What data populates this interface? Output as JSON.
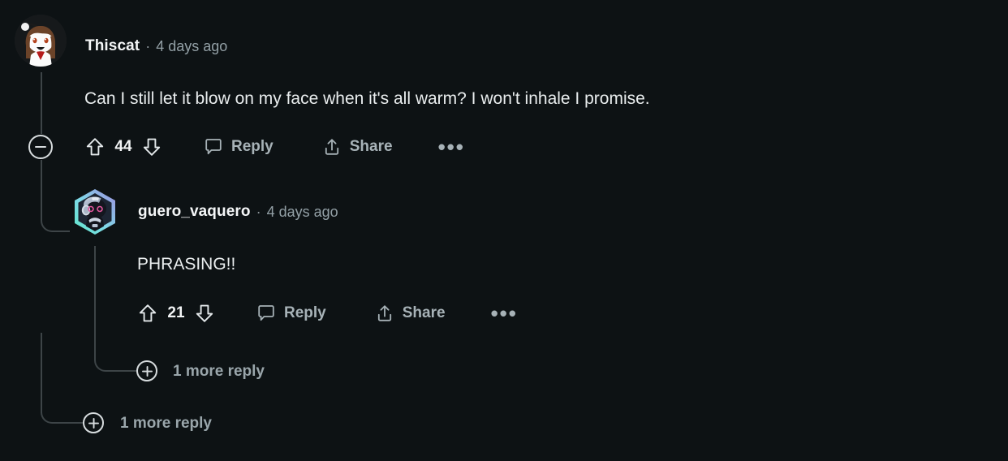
{
  "theme": {
    "background": "#0d1214",
    "text_primary": "#e9edee",
    "text_muted": "#93a0a6",
    "thread_line": "#3d4447",
    "icon_stroke": "#d7dcde"
  },
  "comments": [
    {
      "id": "top-comment",
      "author": "Thiscat",
      "separator": "·",
      "timestamp": "4 days ago",
      "body": "Can I still let it blow on my face when it's all warm? I won't inhale I promise.",
      "avatar_name": "avatar-thiscat",
      "votes": "44",
      "upvote_label": "upvote-icon",
      "downvote_label": "downvote-icon",
      "reply_label": "Reply",
      "share_label": "Share",
      "overflow_label": "•••",
      "collapse_label": "−"
    },
    {
      "id": "nested-comment",
      "author": "guero_vaquero",
      "separator": "·",
      "timestamp": "4 days ago",
      "body": "PHRASING!!",
      "avatar_name": "avatar-guero-vaquero",
      "votes": "21",
      "upvote_label": "upvote-icon",
      "downvote_label": "downvote-icon",
      "reply_label": "Reply",
      "share_label": "Share",
      "overflow_label": "•••"
    }
  ],
  "more_replies": [
    {
      "id": "more-replies-nested",
      "label": "1 more reply",
      "plus": "+"
    },
    {
      "id": "more-replies-top",
      "label": "1 more reply",
      "plus": "+"
    }
  ]
}
